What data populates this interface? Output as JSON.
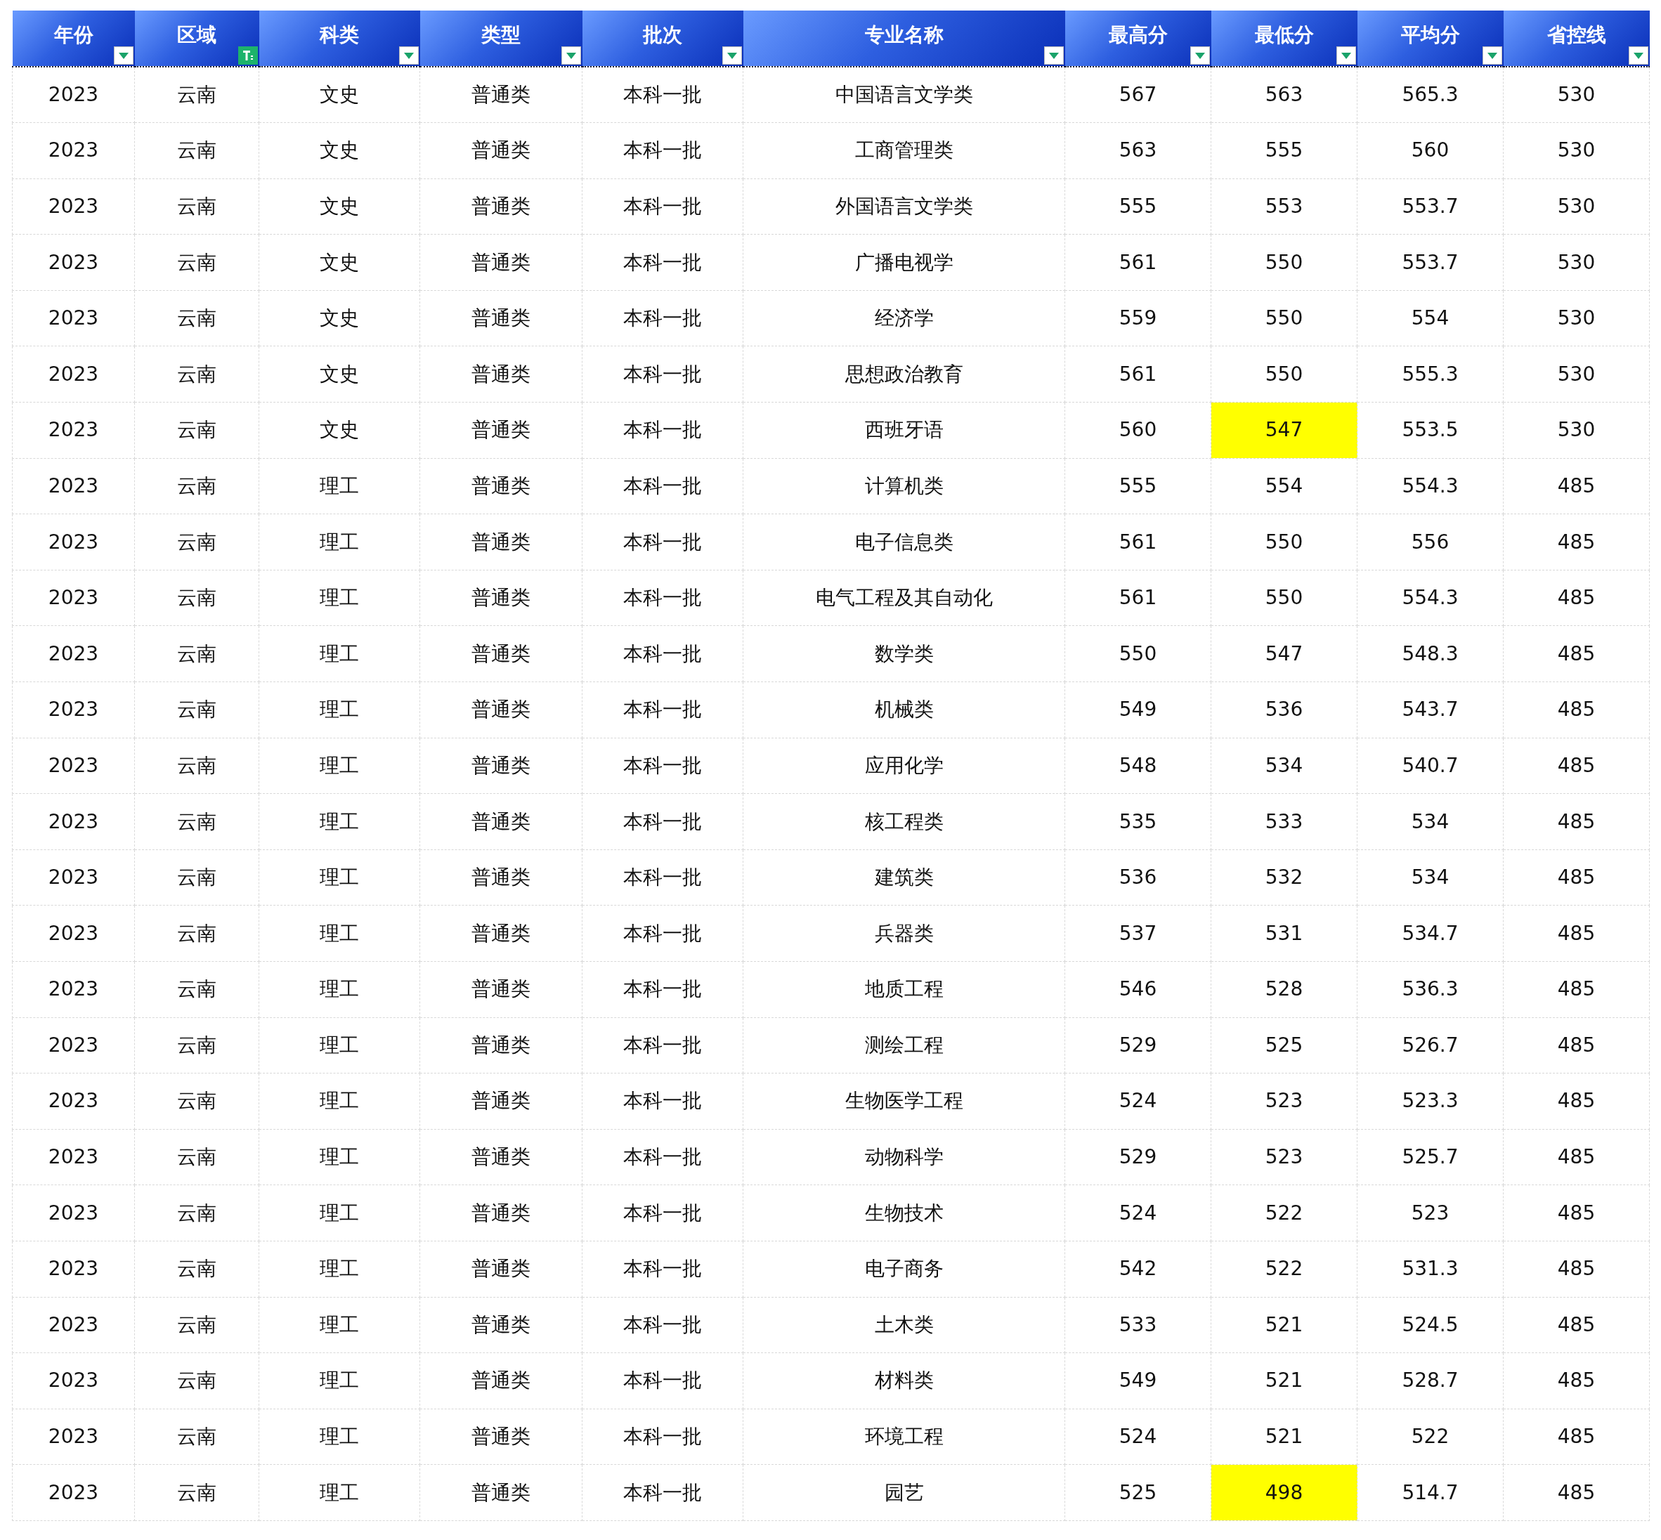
{
  "columns": [
    {
      "label": "年份",
      "filtered": false
    },
    {
      "label": "区域",
      "filtered": true
    },
    {
      "label": "科类",
      "filtered": false
    },
    {
      "label": "类型",
      "filtered": false
    },
    {
      "label": "批次",
      "filtered": false
    },
    {
      "label": "专业名称",
      "filtered": false
    },
    {
      "label": "最高分",
      "filtered": false
    },
    {
      "label": "最低分",
      "filtered": false
    },
    {
      "label": "平均分",
      "filtered": false
    },
    {
      "label": "省控线",
      "filtered": false
    }
  ],
  "rows": [
    {
      "cells": [
        "2023",
        "云南",
        "文史",
        "普通类",
        "本科一批",
        "中国语言文学类",
        "567",
        "563",
        "565.3",
        "530"
      ],
      "min_highlighted": false
    },
    {
      "cells": [
        "2023",
        "云南",
        "文史",
        "普通类",
        "本科一批",
        "工商管理类",
        "563",
        "555",
        "560",
        "530"
      ],
      "min_highlighted": false
    },
    {
      "cells": [
        "2023",
        "云南",
        "文史",
        "普通类",
        "本科一批",
        "外国语言文学类",
        "555",
        "553",
        "553.7",
        "530"
      ],
      "min_highlighted": false
    },
    {
      "cells": [
        "2023",
        "云南",
        "文史",
        "普通类",
        "本科一批",
        "广播电视学",
        "561",
        "550",
        "553.7",
        "530"
      ],
      "min_highlighted": false
    },
    {
      "cells": [
        "2023",
        "云南",
        "文史",
        "普通类",
        "本科一批",
        "经济学",
        "559",
        "550",
        "554",
        "530"
      ],
      "min_highlighted": false
    },
    {
      "cells": [
        "2023",
        "云南",
        "文史",
        "普通类",
        "本科一批",
        "思想政治教育",
        "561",
        "550",
        "555.3",
        "530"
      ],
      "min_highlighted": false
    },
    {
      "cells": [
        "2023",
        "云南",
        "文史",
        "普通类",
        "本科一批",
        "西班牙语",
        "560",
        "547",
        "553.5",
        "530"
      ],
      "min_highlighted": true
    },
    {
      "cells": [
        "2023",
        "云南",
        "理工",
        "普通类",
        "本科一批",
        "计算机类",
        "555",
        "554",
        "554.3",
        "485"
      ],
      "min_highlighted": false
    },
    {
      "cells": [
        "2023",
        "云南",
        "理工",
        "普通类",
        "本科一批",
        "电子信息类",
        "561",
        "550",
        "556",
        "485"
      ],
      "min_highlighted": false
    },
    {
      "cells": [
        "2023",
        "云南",
        "理工",
        "普通类",
        "本科一批",
        "电气工程及其自动化",
        "561",
        "550",
        "554.3",
        "485"
      ],
      "min_highlighted": false
    },
    {
      "cells": [
        "2023",
        "云南",
        "理工",
        "普通类",
        "本科一批",
        "数学类",
        "550",
        "547",
        "548.3",
        "485"
      ],
      "min_highlighted": false
    },
    {
      "cells": [
        "2023",
        "云南",
        "理工",
        "普通类",
        "本科一批",
        "机械类",
        "549",
        "536",
        "543.7",
        "485"
      ],
      "min_highlighted": false
    },
    {
      "cells": [
        "2023",
        "云南",
        "理工",
        "普通类",
        "本科一批",
        "应用化学",
        "548",
        "534",
        "540.7",
        "485"
      ],
      "min_highlighted": false
    },
    {
      "cells": [
        "2023",
        "云南",
        "理工",
        "普通类",
        "本科一批",
        "核工程类",
        "535",
        "533",
        "534",
        "485"
      ],
      "min_highlighted": false
    },
    {
      "cells": [
        "2023",
        "云南",
        "理工",
        "普通类",
        "本科一批",
        "建筑类",
        "536",
        "532",
        "534",
        "485"
      ],
      "min_highlighted": false
    },
    {
      "cells": [
        "2023",
        "云南",
        "理工",
        "普通类",
        "本科一批",
        "兵器类",
        "537",
        "531",
        "534.7",
        "485"
      ],
      "min_highlighted": false
    },
    {
      "cells": [
        "2023",
        "云南",
        "理工",
        "普通类",
        "本科一批",
        "地质工程",
        "546",
        "528",
        "536.3",
        "485"
      ],
      "min_highlighted": false
    },
    {
      "cells": [
        "2023",
        "云南",
        "理工",
        "普通类",
        "本科一批",
        "测绘工程",
        "529",
        "525",
        "526.7",
        "485"
      ],
      "min_highlighted": false
    },
    {
      "cells": [
        "2023",
        "云南",
        "理工",
        "普通类",
        "本科一批",
        "生物医学工程",
        "524",
        "523",
        "523.3",
        "485"
      ],
      "min_highlighted": false
    },
    {
      "cells": [
        "2023",
        "云南",
        "理工",
        "普通类",
        "本科一批",
        "动物科学",
        "529",
        "523",
        "525.7",
        "485"
      ],
      "min_highlighted": false
    },
    {
      "cells": [
        "2023",
        "云南",
        "理工",
        "普通类",
        "本科一批",
        "生物技术",
        "524",
        "522",
        "523",
        "485"
      ],
      "min_highlighted": false
    },
    {
      "cells": [
        "2023",
        "云南",
        "理工",
        "普通类",
        "本科一批",
        "电子商务",
        "542",
        "522",
        "531.3",
        "485"
      ],
      "min_highlighted": false
    },
    {
      "cells": [
        "2023",
        "云南",
        "理工",
        "普通类",
        "本科一批",
        "土木类",
        "533",
        "521",
        "524.5",
        "485"
      ],
      "min_highlighted": false
    },
    {
      "cells": [
        "2023",
        "云南",
        "理工",
        "普通类",
        "本科一批",
        "材料类",
        "549",
        "521",
        "528.7",
        "485"
      ],
      "min_highlighted": false
    },
    {
      "cells": [
        "2023",
        "云南",
        "理工",
        "普通类",
        "本科一批",
        "环境工程",
        "524",
        "521",
        "522",
        "485"
      ],
      "min_highlighted": false
    },
    {
      "cells": [
        "2023",
        "云南",
        "理工",
        "普通类",
        "本科一批",
        "园艺",
        "525",
        "498",
        "514.7",
        "485"
      ],
      "min_highlighted": true
    }
  ]
}
